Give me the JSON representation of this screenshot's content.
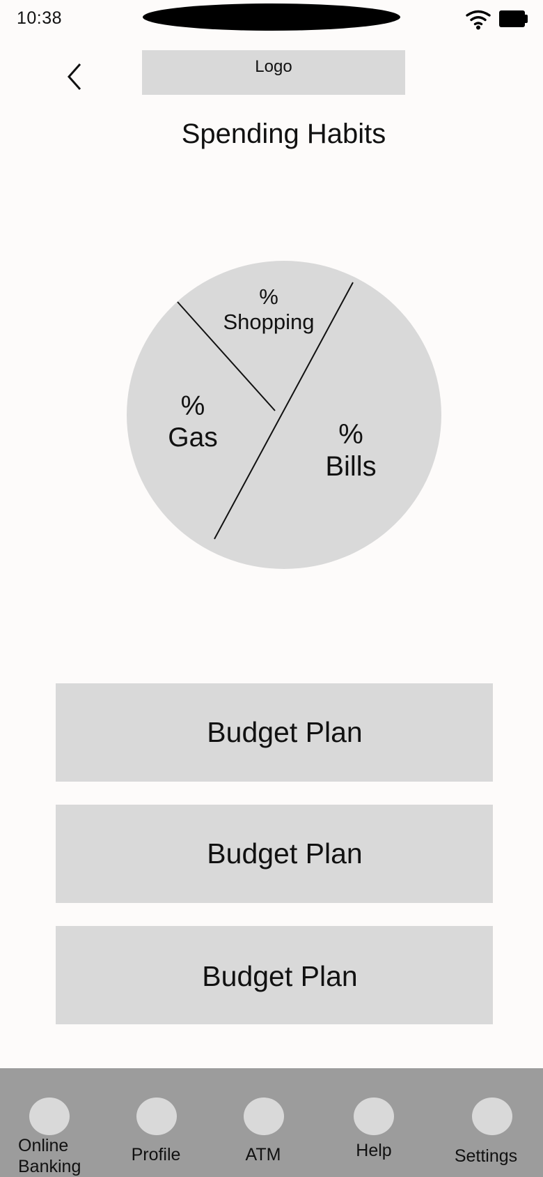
{
  "status_bar": {
    "time": "10:38"
  },
  "header": {
    "back_icon": "chevron-left-icon",
    "logo_text": "Logo"
  },
  "page": {
    "title": "Spending Habits"
  },
  "chart": {
    "segments": [
      {
        "name": "Shopping",
        "percent_label": "%",
        "label": "Shopping"
      },
      {
        "name": "Gas",
        "percent_label": "%",
        "label": "Gas"
      },
      {
        "name": "Bills",
        "percent_label": "%",
        "label": "Bills"
      }
    ],
    "fill_color": "#d9d9d9"
  },
  "budget_plans": [
    {
      "label": "Budget Plan"
    },
    {
      "label": "Budget Plan"
    },
    {
      "label": "Budget Plan"
    }
  ],
  "bottom_nav": {
    "items": [
      {
        "label_line1": "Online",
        "label_line2": "Banking"
      },
      {
        "label": "Profile"
      },
      {
        "label": "ATM"
      },
      {
        "label": "Help"
      },
      {
        "label": "Settings"
      }
    ]
  },
  "colors": {
    "background": "#fdfbfa",
    "placeholder": "#d9d9d9",
    "nav_bar": "#9c9c9c"
  }
}
